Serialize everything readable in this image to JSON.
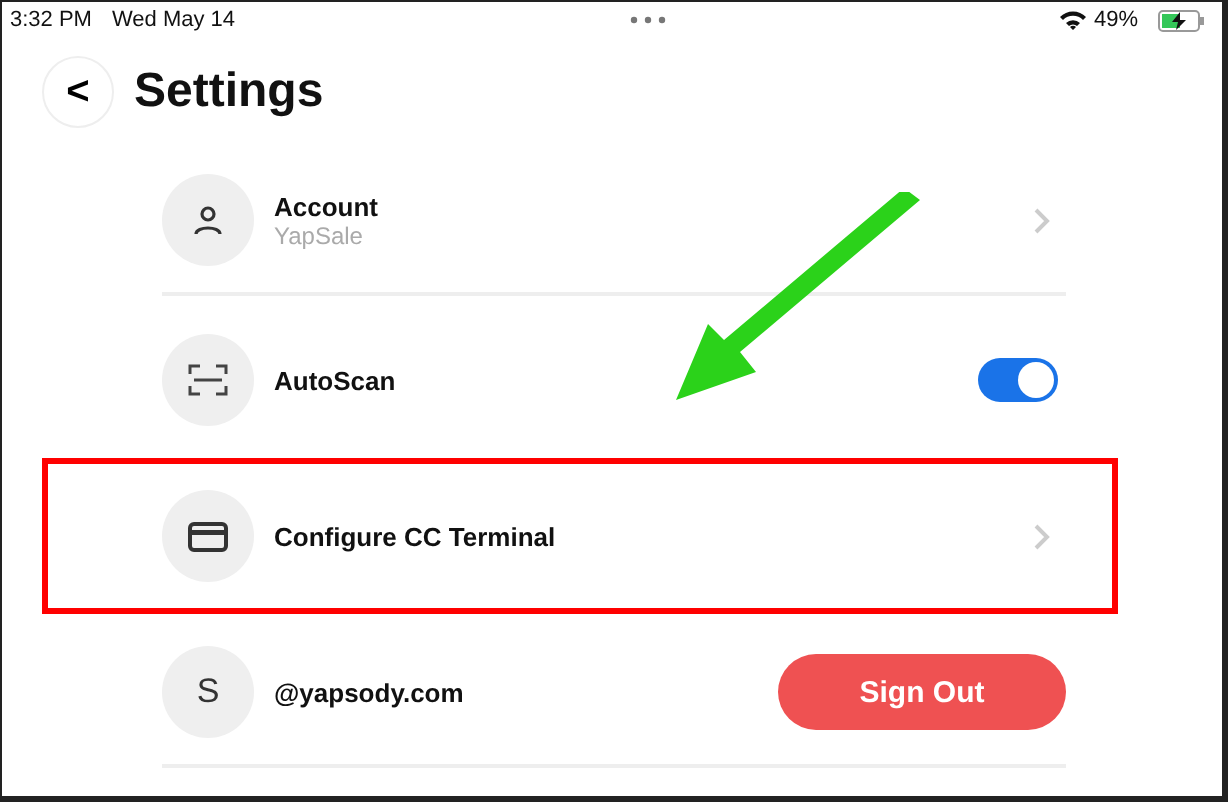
{
  "status_bar": {
    "time": "3:32 PM",
    "date": "Wed May 14",
    "battery": "49%"
  },
  "header": {
    "back": "<",
    "title": "Settings"
  },
  "rows": [
    {
      "kind": "nav",
      "label": "Account",
      "sublabel": "YapSale",
      "highlighted": false
    },
    {
      "kind": "toggle",
      "label": "AutoScan",
      "on": true,
      "highlighted": false
    },
    {
      "kind": "nav",
      "label": "Configure CC Terminal",
      "highlighted": true
    },
    {
      "kind": "account",
      "avatar": "S",
      "label": "@yapsody.com",
      "button": "Sign Out",
      "highlighted": false
    }
  ]
}
